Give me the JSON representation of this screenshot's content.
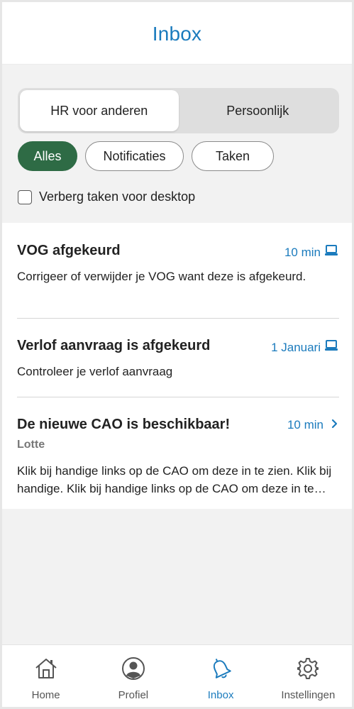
{
  "header": {
    "title": "Inbox"
  },
  "segment": {
    "options": [
      "HR voor anderen",
      "Persoonlijk"
    ],
    "selected": "HR voor anderen"
  },
  "filters": {
    "chips": [
      "Alles",
      "Notificaties",
      "Taken"
    ],
    "selected": "Alles"
  },
  "hide_desktop": {
    "label": "Verberg taken voor desktop",
    "checked": false
  },
  "items": [
    {
      "title": "VOG afgekeurd",
      "time": "10 min",
      "icon": "laptop-icon",
      "body": "Corrigeer of verwijder je VOG want deze is afgekeurd."
    },
    {
      "title": "Verlof aanvraag is afgekeurd",
      "time": "1 Januari",
      "icon": "laptop-icon",
      "body": "Controleer je verlof aanvraag"
    },
    {
      "title": "De nieuwe CAO is beschikbaar!",
      "time": "10 min",
      "icon": "chevron-right-icon",
      "sender": "Lotte",
      "body": "Klik bij handige links op de CAO om deze in te zien. Klik bij handige. Klik bij handige links op de CAO om deze in te zien."
    }
  ],
  "tabbar": {
    "tabs": [
      {
        "label": "Home",
        "icon": "home-icon"
      },
      {
        "label": "Profiel",
        "icon": "profile-icon"
      },
      {
        "label": "Inbox",
        "icon": "bell-icon"
      },
      {
        "label": "Instellingen",
        "icon": "gear-icon"
      }
    ],
    "active": "Inbox"
  },
  "colors": {
    "accent": "#1b7bbd",
    "chip_active": "#2e6b45"
  }
}
